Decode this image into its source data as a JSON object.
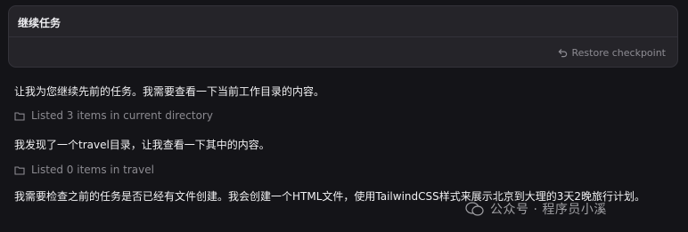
{
  "card": {
    "title": "继续任务",
    "restore_label": "Restore checkpoint"
  },
  "messages": [
    "让我为您继续先前的任务。我需要查看一下当前工作目录的内容。",
    "我发现了一个travel目录，让我查看一下其中的内容。",
    "我需要检查之前的任务是否已经有文件创建。我会创建一个HTML文件，使用TailwindCSS样式来展示北京到大理的3天2晚旅行计划。"
  ],
  "tools": [
    {
      "icon": "folder-icon",
      "label": "Listed 3 items in current directory"
    },
    {
      "icon": "folder-icon",
      "label": "Listed 0 items in travel"
    }
  ],
  "watermark": "公众号 · 程序员小溪",
  "colors": {
    "background": "#141418",
    "card": "#252429",
    "muted_text": "#8b8a90"
  }
}
